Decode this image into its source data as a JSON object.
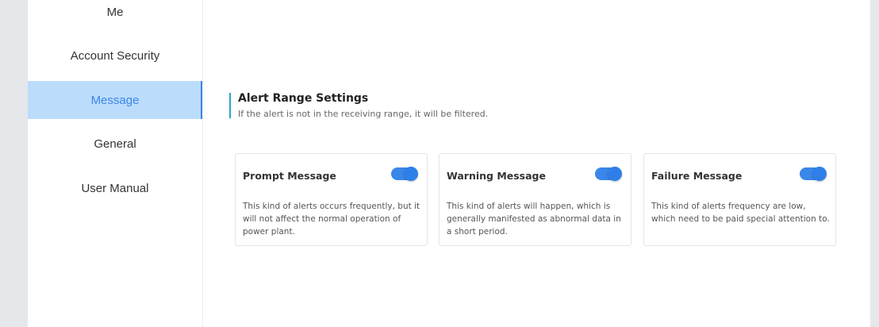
{
  "sidebar": {
    "items": [
      {
        "label": "Me",
        "active": false
      },
      {
        "label": "Account Security",
        "active": false
      },
      {
        "label": "Message",
        "active": true
      },
      {
        "label": "General",
        "active": false
      },
      {
        "label": "User Manual",
        "active": false
      }
    ]
  },
  "section": {
    "title": "Alert Range Settings",
    "description": "If the alert is not in the receiving range, it will be filtered."
  },
  "cards": [
    {
      "title": "Prompt Message",
      "description": "This kind of alerts occurs frequently, but it will not affect the normal operation of power plant.",
      "enabled": true
    },
    {
      "title": "Warning Message",
      "description": "This kind of alerts will happen, which is generally manifested as abnormal data in a short period.",
      "enabled": true
    },
    {
      "title": "Failure Message",
      "description": "This kind of alerts frequency are low, which need to be paid special attention to.",
      "enabled": true
    }
  ],
  "colors": {
    "accent": "#3a86e9",
    "active_bg": "#bcdcfb",
    "section_accent": "#2ba6c8",
    "page_bg": "#e6e7ea"
  }
}
